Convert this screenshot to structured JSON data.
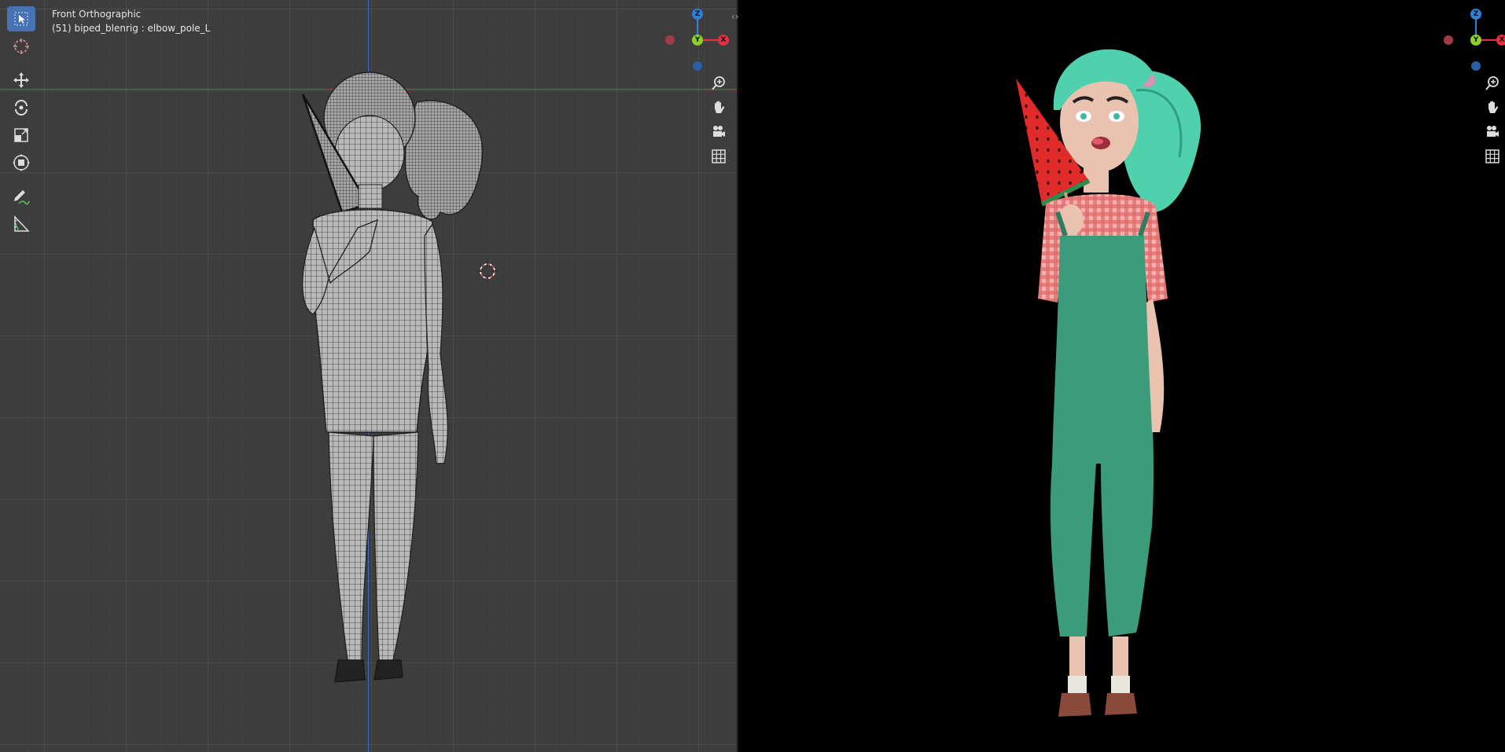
{
  "viewport_left": {
    "view_name": "Front Orthographic",
    "object_info": "(51) biped_blenrig : elbow_pole_L",
    "shading": "wireframe",
    "background_color": "#3d3d3d",
    "x_axis_color": "#b5434d",
    "z_axis_color": "#3d6bc7"
  },
  "viewport_right": {
    "shading": "rendered",
    "background_color": "#000000"
  },
  "toolbar": {
    "tools": [
      {
        "name": "select-box",
        "icon": "cursor-arrow-icon",
        "active": true
      },
      {
        "name": "cursor",
        "icon": "3d-cursor-icon",
        "active": false
      },
      {
        "name": "move",
        "icon": "move-arrows-icon",
        "active": false
      },
      {
        "name": "rotate",
        "icon": "rotate-icon",
        "active": false
      },
      {
        "name": "scale",
        "icon": "scale-icon",
        "active": false
      },
      {
        "name": "transform",
        "icon": "transform-icon",
        "active": false
      },
      {
        "name": "annotate",
        "icon": "pencil-icon",
        "active": false
      },
      {
        "name": "measure",
        "icon": "ruler-icon",
        "active": false
      }
    ],
    "active_color": "#4772b3"
  },
  "gizmo": {
    "z_label": "Z",
    "y_label": "Y",
    "x_label": "X",
    "z_color": "#2d7fd8",
    "y_color": "#8ccf2b",
    "x_color": "#e5303f"
  },
  "navigation": {
    "buttons": [
      "zoom-icon",
      "hand-pan-icon",
      "camera-icon",
      "grid-ortho-icon"
    ]
  },
  "character": {
    "hair_color": "#4fd1ae",
    "shirt_color": "#e06a6a",
    "overalls_color": "#3b9b7a",
    "skin_color": "#eac2b0",
    "watermelon_color": "#e02b2b"
  }
}
